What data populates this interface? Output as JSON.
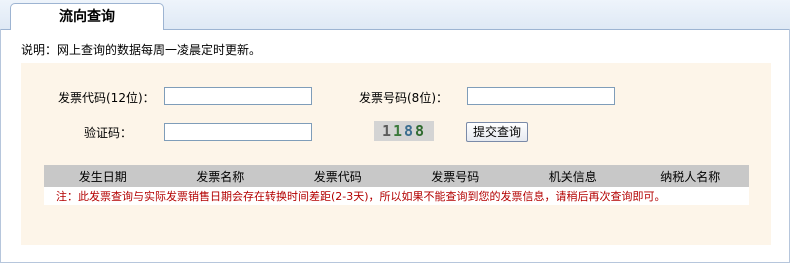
{
  "tab": {
    "title": "流向查询"
  },
  "notice": "说明：网上查询的数据每周一凌晨定时更新。",
  "form": {
    "invoice_code_label": "发票代码(12位)：",
    "invoice_number_label": "发票号码(8位)：",
    "captcha_label": "验证码：",
    "invoice_code_value": "",
    "invoice_number_value": "",
    "captcha_value": "",
    "captcha_chars": [
      "1",
      "1",
      "8",
      "8"
    ],
    "submit_label": "提交查询"
  },
  "table": {
    "headers": [
      "发生日期",
      "发票名称",
      "发票代码",
      "发票号码",
      "机关信息",
      "纳税人名称"
    ],
    "note": "注：此发票查询与实际发票销售日期会存在转换时间差距(2-3天)，所以如果不能查询到您的发票信息，请稍后再次查询即可。"
  },
  "colors": {
    "form_background": "#fdf5e9",
    "header_background": "#c8c8c8",
    "note_text": "#b30000",
    "tab_border": "#9db4d2"
  }
}
